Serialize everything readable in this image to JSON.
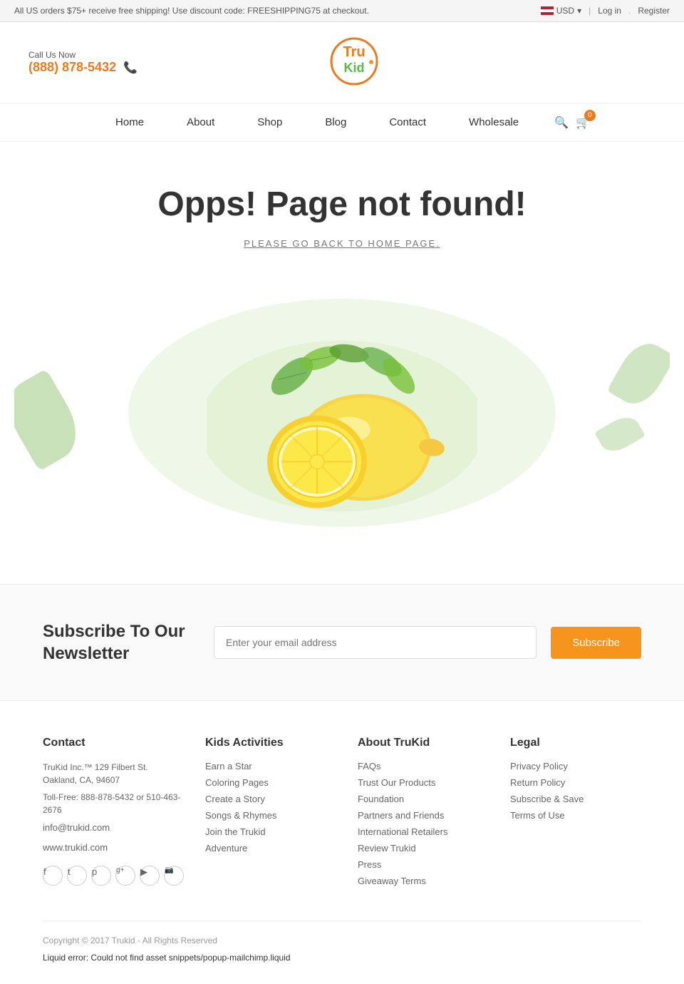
{
  "topBar": {
    "promo": "All US orders $75+ receive free shipping! Use discount code: FREESHIPPING75 at checkout.",
    "currency": "USD",
    "login": "Log in",
    "register": "Register"
  },
  "header": {
    "callLabel": "Call Us Now",
    "phone": "(888) 878-5432",
    "logoAlt": "TruKid"
  },
  "nav": {
    "items": [
      {
        "label": "Home",
        "href": "#"
      },
      {
        "label": "About",
        "href": "#"
      },
      {
        "label": "Shop",
        "href": "#"
      },
      {
        "label": "Blog",
        "href": "#"
      },
      {
        "label": "Contact",
        "href": "#"
      },
      {
        "label": "Wholesale",
        "href": "#"
      }
    ],
    "cartCount": "0"
  },
  "errorPage": {
    "title": "Opps! Page not found!",
    "subtitle": "PLEASE GO BACK TO HOME PAGE."
  },
  "newsletter": {
    "title": "Subscribe To Our Newsletter",
    "placeholder": "Enter your email address",
    "buttonLabel": "Subscribe"
  },
  "footer": {
    "contact": {
      "title": "Contact",
      "address": "TruKid Inc.™ 129 Filbert St. Oakland, CA, 94607",
      "tollfree": "Toll-Free: 888-878-5432 or 510-463-2676",
      "email": "info@trukid.com",
      "website": "www.trukid.com"
    },
    "kidsActivities": {
      "title": "Kids Activities",
      "links": [
        "Earn a Star",
        "Coloring Pages",
        "Create a Story",
        "Songs & Rhymes",
        "Join the Trukid",
        "Adventure"
      ]
    },
    "aboutTrukid": {
      "title": "About TruKid",
      "links": [
        "FAQs",
        "Trust Our Products",
        "Foundation",
        "Partners and Friends",
        "International Retailers",
        "Review Trukid",
        "Press",
        "Giveaway Terms"
      ]
    },
    "legal": {
      "title": "Legal",
      "links": [
        "Privacy Policy",
        "Return Policy",
        "Subscribe & Save",
        "Terms of Use"
      ]
    },
    "copyright": "Copyright © 2017 Trukid - All Rights Reserved",
    "liquidError": "Liquid error: Could not find asset snippets/popup-mailchimp.liquid",
    "social": [
      {
        "name": "facebook",
        "icon": "f"
      },
      {
        "name": "twitter",
        "icon": "t"
      },
      {
        "name": "pinterest",
        "icon": "p"
      },
      {
        "name": "google-plus",
        "icon": "g+"
      },
      {
        "name": "youtube",
        "icon": "▶"
      },
      {
        "name": "instagram",
        "icon": "📷"
      }
    ]
  }
}
